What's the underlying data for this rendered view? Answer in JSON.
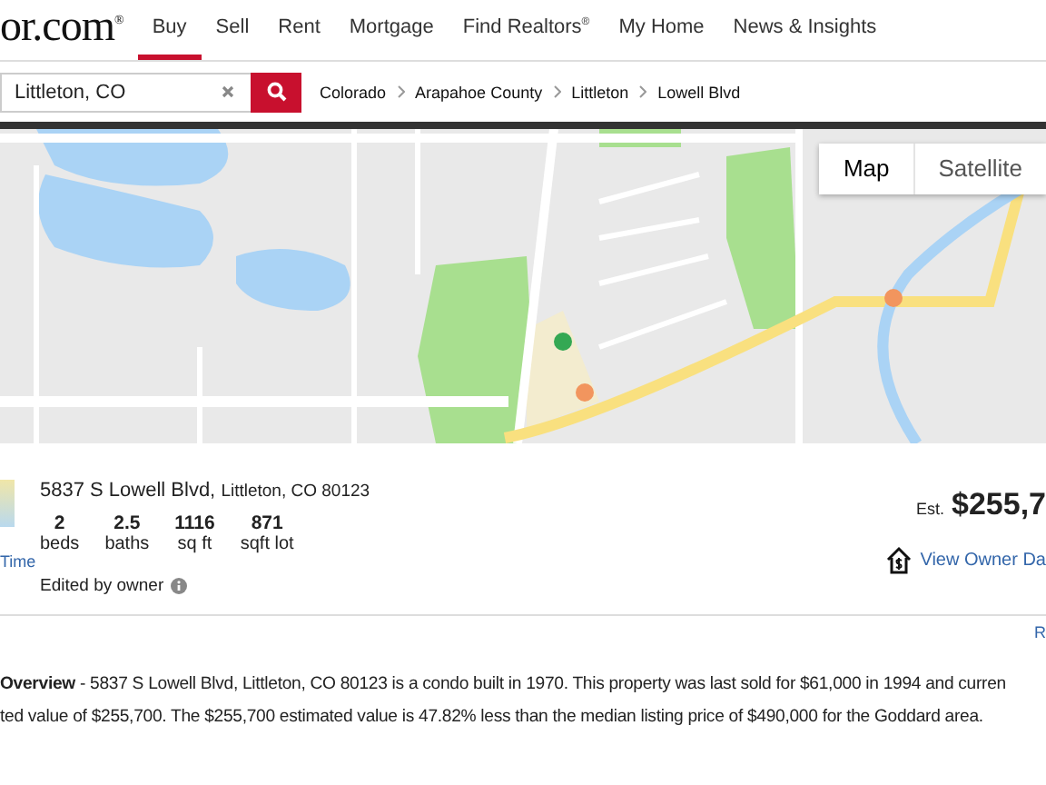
{
  "logo": {
    "text": "or.com",
    "mark": "®"
  },
  "nav": [
    {
      "label": "Buy",
      "selected": true
    },
    {
      "label": "Sell",
      "selected": false
    },
    {
      "label": "Rent",
      "selected": false
    },
    {
      "label": "Mortgage",
      "selected": false
    },
    {
      "label": "Find Realtors$^{®}$",
      "selected": false
    },
    {
      "label": "My Home",
      "selected": false
    },
    {
      "label": "News & Insights",
      "selected": false
    }
  ],
  "search": {
    "value": "Littleton, CO"
  },
  "breadcrumbs": [
    "Colorado",
    "Arapahoe County",
    "Littleton",
    "Lowell Blvd"
  ],
  "map": {
    "map_types": [
      {
        "label": "Map",
        "selected": true
      },
      {
        "label": "Satellite",
        "selected": false
      }
    ]
  },
  "property": {
    "side_link": "Time",
    "street": "5837 S Lowell Blvd,",
    "city": "Littleton, CO 80123",
    "stats": [
      {
        "value": "2",
        "label": "beds"
      },
      {
        "value": "2.5",
        "label": "baths"
      },
      {
        "value": "1116",
        "label": "sq ft"
      },
      {
        "value": "871",
        "label": "sqft lot"
      }
    ],
    "edited_note": "Edited by owner",
    "estimate_label": "Est.",
    "estimate": "$255,7",
    "owner_link": "View Owner Da"
  },
  "edge_link": "R",
  "overview": [
    "**Overview** - 5837 S Lowell Blvd, Littleton, CO 80123 is a condo built in 1970. This property was last sold for $61,000 in 1994 and curren",
    "ted value of $255,700. The $255,700 estimated value is 47.82% less than the median listing price of $490,000 for the Goddard area."
  ]
}
